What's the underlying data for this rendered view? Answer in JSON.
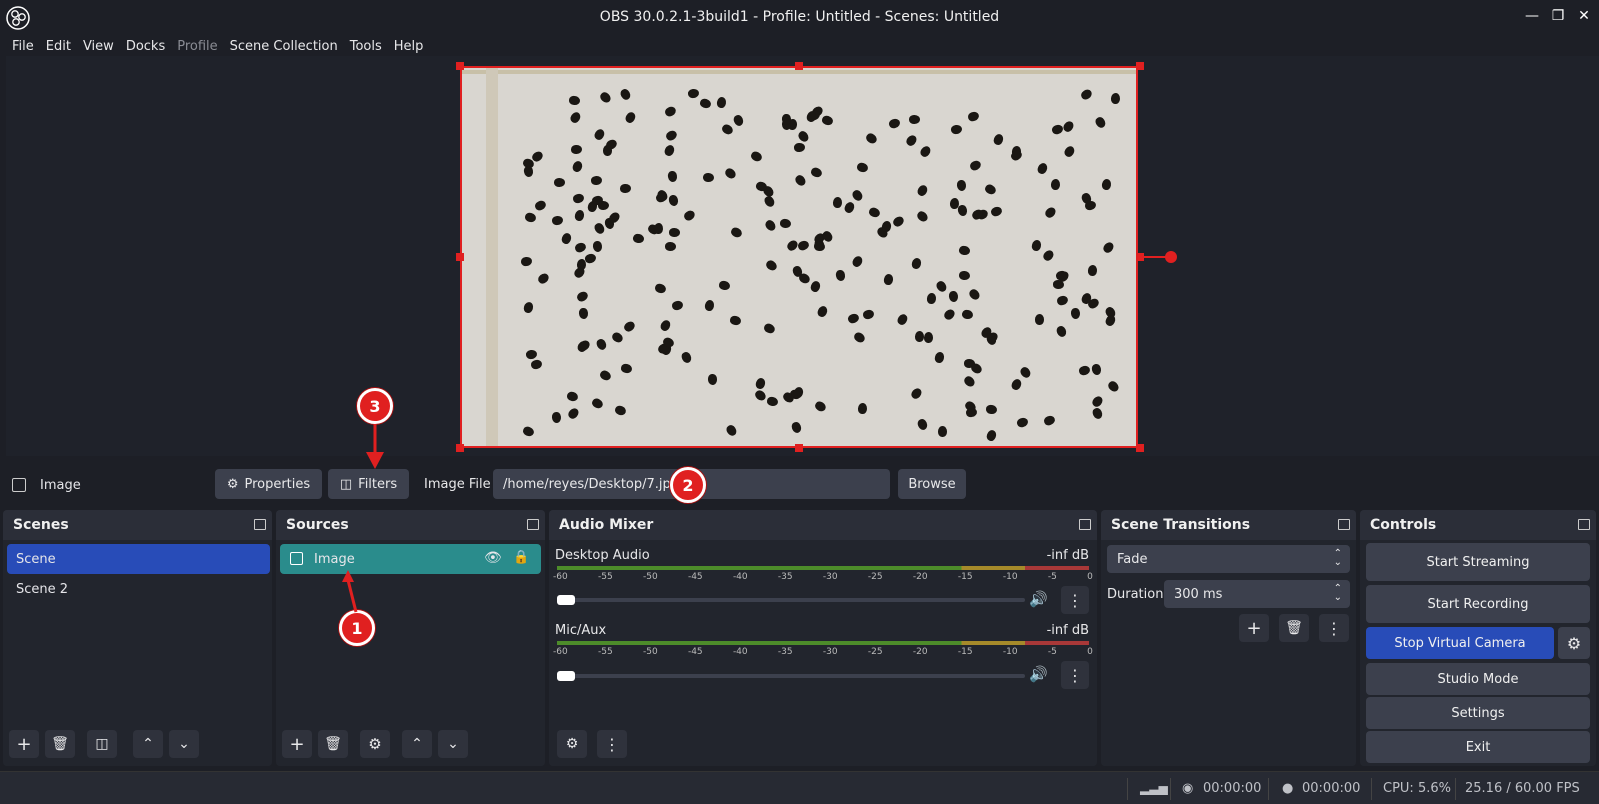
{
  "window": {
    "title": "OBS 30.0.2.1-3build1 - Profile: Untitled - Scenes: Untitled"
  },
  "menu": {
    "file": "File",
    "edit": "Edit",
    "view": "View",
    "docks": "Docks",
    "profile": "Profile",
    "scene_collection": "Scene Collection",
    "tools": "Tools",
    "help": "Help"
  },
  "source_bar": {
    "source_name": "Image",
    "properties_label": "Properties",
    "filters_label": "Filters",
    "image_file_label": "Image File",
    "image_file_value": "/home/reyes/Desktop/7.jpg",
    "browse_label": "Browse"
  },
  "scenes": {
    "title": "Scenes",
    "items": [
      "Scene",
      "Scene 2"
    ]
  },
  "sources": {
    "title": "Sources",
    "items": [
      "Image"
    ]
  },
  "audio_mixer": {
    "title": "Audio Mixer",
    "channels": [
      {
        "name": "Desktop Audio",
        "level": "-inf dB"
      },
      {
        "name": "Mic/Aux",
        "level": "-inf dB"
      }
    ],
    "ticks": [
      "-60",
      "-55",
      "-50",
      "-45",
      "-40",
      "-35",
      "-30",
      "-25",
      "-20",
      "-15",
      "-10",
      "-5",
      "0"
    ]
  },
  "scene_transitions": {
    "title": "Scene Transitions",
    "transition": "Fade",
    "duration_label": "Duration",
    "duration_value": "300 ms"
  },
  "controls": {
    "title": "Controls",
    "start_streaming": "Start Streaming",
    "start_recording": "Start Recording",
    "stop_virtual_camera": "Stop Virtual Camera",
    "studio_mode": "Studio Mode",
    "settings": "Settings",
    "exit": "Exit"
  },
  "status": {
    "stream_time": "00:00:00",
    "record_time": "00:00:00",
    "cpu": "CPU: 5.6%",
    "fps": "25.16 / 60.00 FPS"
  },
  "annotations": {
    "badge_1": "1",
    "badge_2": "2",
    "badge_3": "3"
  },
  "colors": {
    "accent_blue": "#284cb8",
    "source_selected": "#2a8c8c",
    "selection_red": "#e02020"
  }
}
